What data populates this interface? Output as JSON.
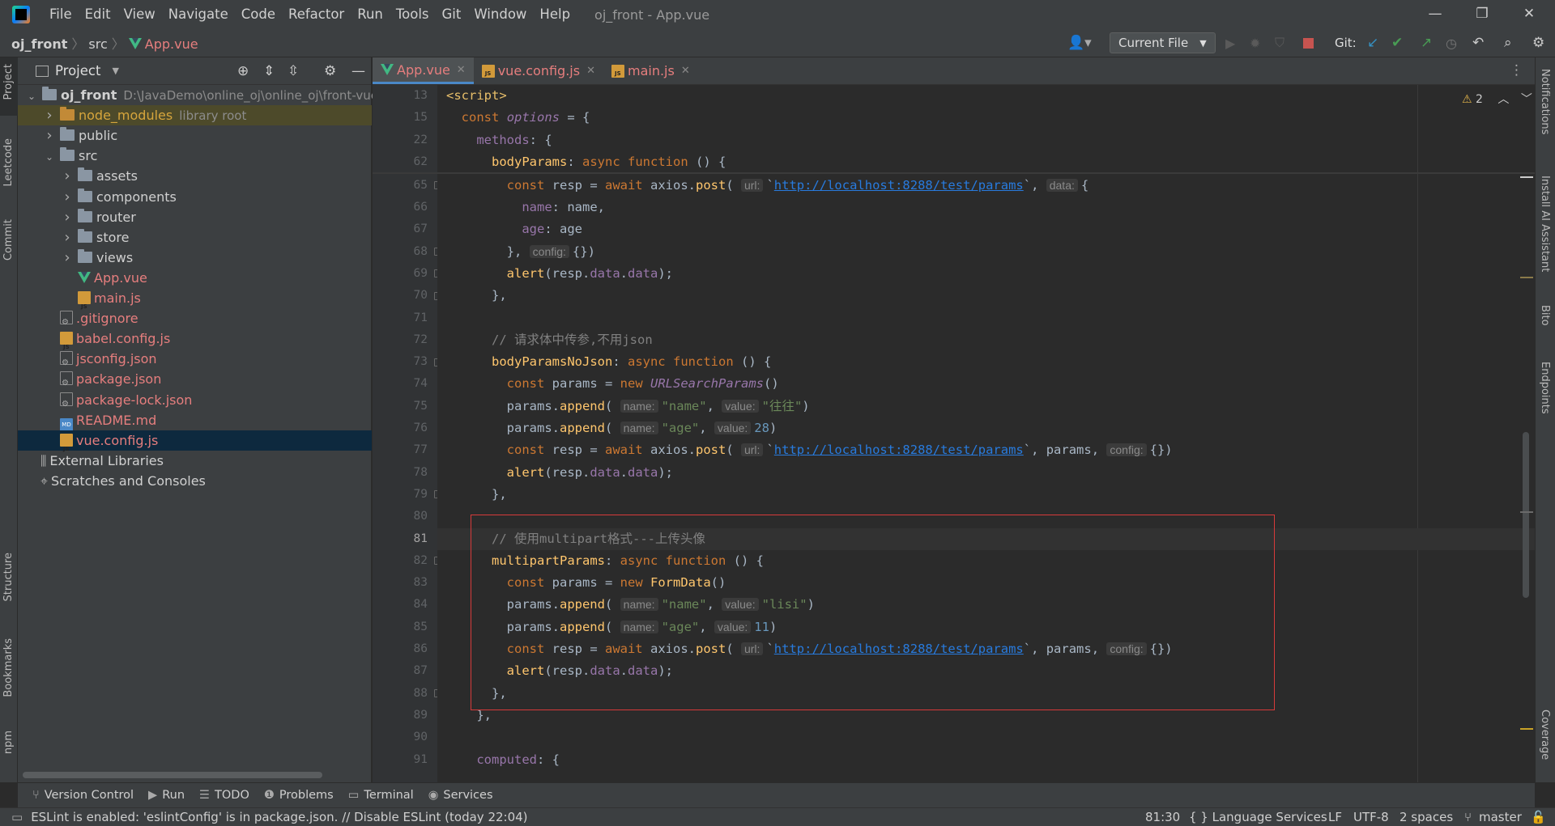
{
  "menu": [
    "File",
    "Edit",
    "View",
    "Navigate",
    "Code",
    "Refactor",
    "Run",
    "Tools",
    "Git",
    "Window",
    "Help"
  ],
  "window_title": "oj_front - App.vue",
  "breadcrumb": [
    "oj_front",
    "src",
    "App.vue"
  ],
  "run_config": "Current File",
  "git_label": "Git:",
  "project_panel": {
    "title": "Project"
  },
  "tree": [
    {
      "label": "oj_front",
      "extra": "D:\\JavaDemo\\online_oj\\online_oj\\front-vue",
      "depth": 0,
      "arrow": "v",
      "type": "folder",
      "bold": true
    },
    {
      "label": "node_modules",
      "extra": "library root",
      "depth": 1,
      "arrow": ">",
      "type": "folder-orange",
      "color": "#d6a53c"
    },
    {
      "label": "public",
      "depth": 1,
      "arrow": ">",
      "type": "folder"
    },
    {
      "label": "src",
      "depth": 1,
      "arrow": "v",
      "type": "folder"
    },
    {
      "label": "assets",
      "depth": 2,
      "arrow": ">",
      "type": "folder"
    },
    {
      "label": "components",
      "depth": 2,
      "arrow": ">",
      "type": "folder"
    },
    {
      "label": "router",
      "depth": 2,
      "arrow": ">",
      "type": "folder"
    },
    {
      "label": "store",
      "depth": 2,
      "arrow": ">",
      "type": "folder"
    },
    {
      "label": "views",
      "depth": 2,
      "arrow": ">",
      "type": "folder"
    },
    {
      "label": "App.vue",
      "depth": 2,
      "arrow": "",
      "type": "vue",
      "color": "#e67e7e"
    },
    {
      "label": "main.js",
      "depth": 2,
      "arrow": "",
      "type": "js",
      "color": "#e67e7e"
    },
    {
      "label": ".gitignore",
      "depth": 1,
      "arrow": "",
      "type": "cfg",
      "color": "#e67e7e"
    },
    {
      "label": "babel.config.js",
      "depth": 1,
      "arrow": "",
      "type": "js",
      "color": "#e67e7e"
    },
    {
      "label": "jsconfig.json",
      "depth": 1,
      "arrow": "",
      "type": "cfg",
      "color": "#e67e7e"
    },
    {
      "label": "package.json",
      "depth": 1,
      "arrow": "",
      "type": "cfg",
      "color": "#e67e7e"
    },
    {
      "label": "package-lock.json",
      "depth": 1,
      "arrow": "",
      "type": "cfg",
      "color": "#e67e7e"
    },
    {
      "label": "README.md",
      "depth": 1,
      "arrow": "",
      "type": "md",
      "color": "#e67e7e"
    },
    {
      "label": "vue.config.js",
      "depth": 1,
      "arrow": "",
      "type": "js",
      "color": "#e67e7e",
      "selected": true
    },
    {
      "label": "External Libraries",
      "depth": 0,
      "arrow": "",
      "type": "lib"
    },
    {
      "label": "Scratches and Consoles",
      "depth": 0,
      "arrow": "",
      "type": "scratch"
    }
  ],
  "editor_tabs": [
    {
      "label": "App.vue",
      "type": "vue",
      "active": true
    },
    {
      "label": "vue.config.js",
      "type": "js"
    },
    {
      "label": "main.js",
      "type": "js"
    }
  ],
  "warnings": "2",
  "sticky_lines": [
    {
      "ln": "13",
      "html": "<span class='tg'>&lt;script&gt;</span>"
    },
    {
      "ln": "15",
      "html": "  <span class='k'>const</span> <span class='p ital'>options</span> = {"
    },
    {
      "ln": "22",
      "html": "    <span class='p'>methods</span>: {"
    },
    {
      "ln": "62",
      "html": "      <span class='f'>bodyParams</span>: <span class='k'>async</span> <span class='k'>function</span> () {"
    }
  ],
  "code_lines": [
    {
      "ln": "65",
      "html": "        <span class='k'>const</span> resp = <span class='k'>await</span> axios.<span class='f'>post</span>( <span class='hint'>url:</span>`<span class='u'>http://localhost:8288/test/params</span>`, <span class='hint'>data:</span>{"
    },
    {
      "ln": "66",
      "html": "          <span class='p'>name</span>: name,"
    },
    {
      "ln": "67",
      "html": "          <span class='p'>age</span>: age"
    },
    {
      "ln": "68",
      "html": "        }, <span class='hint'>config:</span>{})"
    },
    {
      "ln": "69",
      "html": "        <span class='f'>alert</span>(resp.<span class='p'>data</span>.<span class='p'>data</span>);"
    },
    {
      "ln": "70",
      "html": "      },"
    },
    {
      "ln": "71",
      "html": ""
    },
    {
      "ln": "72",
      "html": "      <span class='c'>// 请求体中传参,不用json</span>"
    },
    {
      "ln": "73",
      "html": "      <span class='f'>bodyParamsNoJson</span>: <span class='k'>async</span> <span class='k'>function</span> () {"
    },
    {
      "ln": "74",
      "html": "        <span class='k'>const</span> params = <span class='k'>new</span> <span class='p ital'>URLSearchParams</span>()"
    },
    {
      "ln": "75",
      "html": "        params.<span class='f'>append</span>( <span class='hint'>name:</span><span class='s'>\"name\"</span>, <span class='hint'>value:</span><span class='s'>\"往往\"</span>)"
    },
    {
      "ln": "76",
      "html": "        params.<span class='f'>append</span>( <span class='hint'>name:</span><span class='s'>\"age\"</span>, <span class='hint'>value:</span><span class='n'>28</span>)"
    },
    {
      "ln": "77",
      "html": "        <span class='k'>const</span> resp = <span class='k'>await</span> axios.<span class='f'>post</span>( <span class='hint'>url:</span>`<span class='u'>http://localhost:8288/test/params</span>`, params, <span class='hint'>config:</span>{})"
    },
    {
      "ln": "78",
      "html": "        <span class='f'>alert</span>(resp.<span class='p'>data</span>.<span class='p'>data</span>);"
    },
    {
      "ln": "79",
      "html": "      },"
    },
    {
      "ln": "80",
      "html": ""
    },
    {
      "ln": "81",
      "html": "      <span class='c'>// 使用multipart格式---上传头像</span>",
      "current": true
    },
    {
      "ln": "82",
      "html": "      <span class='f'>multipartParams</span>: <span class='k'>async</span> <span class='k'>function</span> () {"
    },
    {
      "ln": "83",
      "html": "        <span class='k'>const</span> params = <span class='k'>new</span> <span class='f'>FormData</span>()"
    },
    {
      "ln": "84",
      "html": "        params.<span class='f'>append</span>( <span class='hint'>name:</span><span class='s'>\"name\"</span>, <span class='hint'>value:</span><span class='s'>\"lisi\"</span>)"
    },
    {
      "ln": "85",
      "html": "        params.<span class='f'>append</span>( <span class='hint'>name:</span><span class='s'>\"age\"</span>, <span class='hint'>value:</span><span class='n'>11</span>)"
    },
    {
      "ln": "86",
      "html": "        <span class='k'>const</span> resp = <span class='k'>await</span> axios.<span class='f'>post</span>( <span class='hint'>url:</span>`<span class='u'>http://localhost:8288/test/params</span>`, params, <span class='hint'>config:</span>{})"
    },
    {
      "ln": "87",
      "html": "        <span class='f'>alert</span>(resp.<span class='p'>data</span>.<span class='p'>data</span>);"
    },
    {
      "ln": "88",
      "html": "      },"
    },
    {
      "ln": "89",
      "html": "    },"
    },
    {
      "ln": "90",
      "html": ""
    },
    {
      "ln": "91",
      "html": "    <span class='p'>computed</span>: {"
    }
  ],
  "left_tools": [
    "Project",
    "Leetcode",
    "Commit",
    "Structure",
    "Bookmarks",
    "npm"
  ],
  "right_tools": [
    "Notifications",
    "Install AI Assistant",
    "Bito",
    "Endpoints",
    "Coverage"
  ],
  "bottom_tabs": [
    {
      "label": "Version Control",
      "icon": "⑂"
    },
    {
      "label": "Run",
      "icon": "▶"
    },
    {
      "label": "TODO",
      "icon": "☰"
    },
    {
      "label": "Problems",
      "icon": "❶"
    },
    {
      "label": "Terminal",
      "icon": "▭"
    },
    {
      "label": "Services",
      "icon": "◉"
    }
  ],
  "status": {
    "message": "ESLint is enabled: 'eslintConfig' is in package.json. // Disable ESLint (today 22:04)",
    "position": "81:30",
    "lang": "{ } Language Services",
    "line_sep": "LF",
    "encoding": "UTF-8",
    "indent": "2 spaces",
    "branch": "master"
  }
}
